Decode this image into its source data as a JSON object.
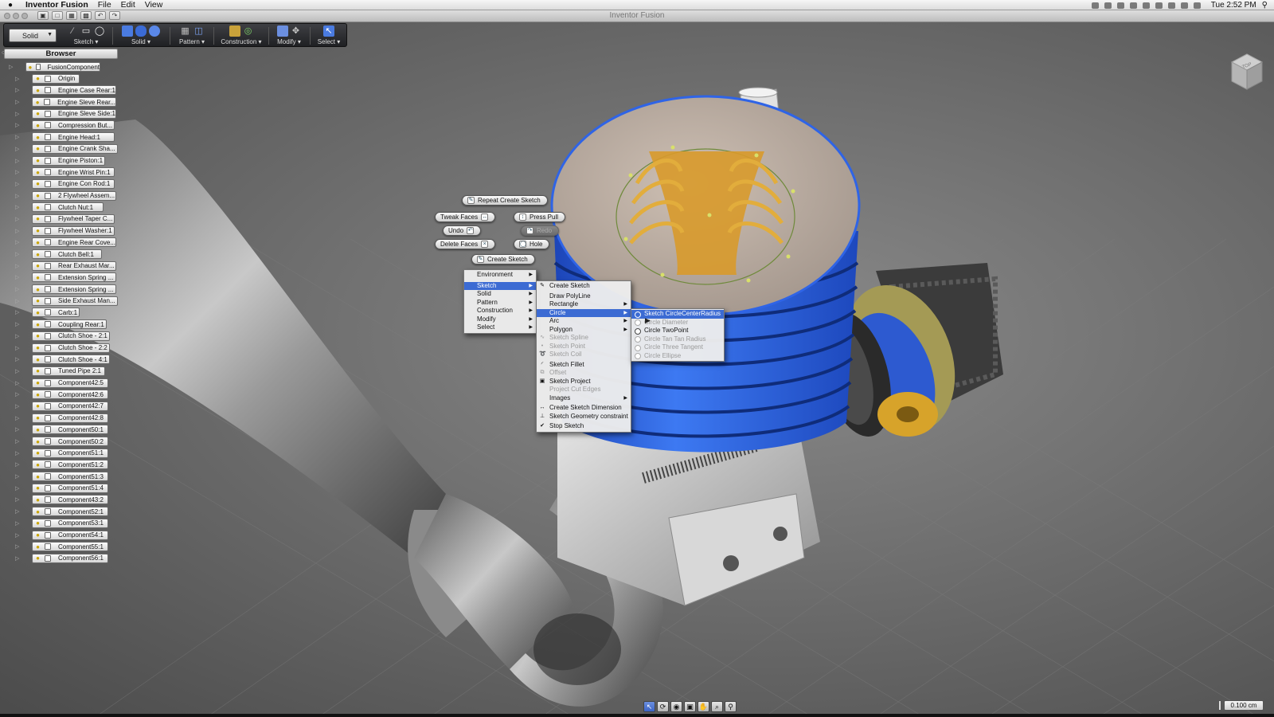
{
  "menubar": {
    "app_name": "Inventor Fusion",
    "menus": [
      "File",
      "Edit",
      "View"
    ],
    "clock": "Tue 2:52 PM"
  },
  "window": {
    "title": "Inventor Fusion"
  },
  "toolbar": {
    "workspace_value": "Solid",
    "groups": [
      {
        "label": "Sketch",
        "icon": "sketch-icon"
      },
      {
        "label": "Solid",
        "icon": "solid-icon"
      },
      {
        "label": "Pattern",
        "icon": "pattern-icon"
      },
      {
        "label": "Construction",
        "icon": "construction-icon"
      },
      {
        "label": "Modify",
        "icon": "modify-icon"
      },
      {
        "label": "Select",
        "icon": "select-arrow-icon"
      }
    ]
  },
  "browser": {
    "title": "Browser",
    "items": [
      {
        "label": "FusionComponent",
        "level": 0
      },
      {
        "label": "Origin",
        "level": 1
      },
      {
        "label": "Engine Case Rear:1",
        "level": 1
      },
      {
        "label": "Engine Sleve Rear...",
        "level": 1
      },
      {
        "label": "Engine Sleve Side:1",
        "level": 1
      },
      {
        "label": "Compression But...",
        "level": 1
      },
      {
        "label": "Engine Head:1",
        "level": 1
      },
      {
        "label": "Engine Crank Sha...",
        "level": 1
      },
      {
        "label": "Engine Piston:1",
        "level": 1
      },
      {
        "label": "Engine Wrist Pin:1",
        "level": 1
      },
      {
        "label": "Engine Con Rod:1",
        "level": 1
      },
      {
        "label": "2 Flywheel Assem...",
        "level": 1
      },
      {
        "label": "Clutch Nut:1",
        "level": 1
      },
      {
        "label": "Flywheel Taper C...",
        "level": 1
      },
      {
        "label": "Flywheel Washer:1",
        "level": 1
      },
      {
        "label": "Engine Rear Cove...",
        "level": 1
      },
      {
        "label": "Clutch Bell:1",
        "level": 1
      },
      {
        "label": "Rear Exhaust Mar...",
        "level": 1
      },
      {
        "label": "Extension Spring ...",
        "level": 1
      },
      {
        "label": "Extension Spring ...",
        "level": 1
      },
      {
        "label": "Side Exhaust Man...",
        "level": 1
      },
      {
        "label": "Carb:1",
        "level": 1
      },
      {
        "label": "Coupling Rear:1",
        "level": 1
      },
      {
        "label": "Clutch Shoe - 2:1",
        "level": 1
      },
      {
        "label": "Clutch Shoe - 2:2",
        "level": 1
      },
      {
        "label": "Clutch Shoe - 4:1",
        "level": 1
      },
      {
        "label": "Tuned Pipe 2:1",
        "level": 1
      },
      {
        "label": "Component42:5",
        "level": 1
      },
      {
        "label": "Component42:6",
        "level": 1
      },
      {
        "label": "Component42:7",
        "level": 1
      },
      {
        "label": "Component42:8",
        "level": 1
      },
      {
        "label": "Component50:1",
        "level": 1
      },
      {
        "label": "Component50:2",
        "level": 1
      },
      {
        "label": "Component51:1",
        "level": 1
      },
      {
        "label": "Component51:2",
        "level": 1
      },
      {
        "label": "Component51:3",
        "level": 1
      },
      {
        "label": "Component51:4",
        "level": 1
      },
      {
        "label": "Component43:2",
        "level": 1
      },
      {
        "label": "Component52:1",
        "level": 1
      },
      {
        "label": "Component53:1",
        "level": 1
      },
      {
        "label": "Component54:1",
        "level": 1
      },
      {
        "label": "Component55:1",
        "level": 1
      },
      {
        "label": "Component56:1",
        "level": 1
      }
    ]
  },
  "marking_menu": {
    "repeat": "Repeat Create Sketch",
    "tweak_faces": "Tweak Faces",
    "press_pull": "Press Pull",
    "undo": "Undo",
    "redo": "Redo",
    "delete_faces": "Delete Faces",
    "hole": "Hole",
    "create_sketch": "Create Sketch"
  },
  "context_menu": {
    "level1": [
      "Environment",
      "Sketch",
      "Solid",
      "Pattern",
      "Construction",
      "Modify",
      "Select"
    ],
    "level2": [
      {
        "label": "Create Sketch",
        "enabled": true,
        "submenu": false,
        "icon": "sketch-icon"
      },
      {
        "label": "Draw PolyLine",
        "enabled": true,
        "submenu": false,
        "icon": ""
      },
      {
        "label": "Rectangle",
        "enabled": true,
        "submenu": true,
        "icon": ""
      },
      {
        "label": "Circle",
        "enabled": true,
        "submenu": true,
        "icon": ""
      },
      {
        "label": "Arc",
        "enabled": true,
        "submenu": true,
        "icon": ""
      },
      {
        "label": "Polygon",
        "enabled": true,
        "submenu": true,
        "icon": ""
      },
      {
        "label": "Sketch Spline",
        "enabled": false,
        "submenu": false,
        "icon": "spline-icon"
      },
      {
        "label": "Sketch Point",
        "enabled": false,
        "submenu": false,
        "icon": "point-icon"
      },
      {
        "label": "Sketch Coil",
        "enabled": false,
        "submenu": false,
        "icon": "coil-icon"
      },
      {
        "label": "Sketch Fillet",
        "enabled": true,
        "submenu": false,
        "icon": "fillet-icon"
      },
      {
        "label": "Offset",
        "enabled": false,
        "submenu": false,
        "icon": "offset-icon"
      },
      {
        "label": "Sketch Project",
        "enabled": true,
        "submenu": false,
        "icon": "project-icon"
      },
      {
        "label": "Project Cut Edges",
        "enabled": false,
        "submenu": false,
        "icon": ""
      },
      {
        "label": "Images",
        "enabled": true,
        "submenu": true,
        "icon": ""
      },
      {
        "label": "Create Sketch Dimension",
        "enabled": true,
        "submenu": false,
        "icon": "dimension-icon"
      },
      {
        "label": "Sketch Geometry constraint",
        "enabled": true,
        "submenu": false,
        "icon": "constraint-icon"
      },
      {
        "label": "Stop Sketch",
        "enabled": true,
        "submenu": false,
        "icon": "stop-icon"
      }
    ],
    "level3": [
      {
        "label": "Sketch CircleCenterRadius",
        "enabled": true
      },
      {
        "label": "Circle Diameter",
        "enabled": false
      },
      {
        "label": "Circle TwoPoint",
        "enabled": true
      },
      {
        "label": "Circle Tan Tan Radius",
        "enabled": false
      },
      {
        "label": "Circle Three Tangent",
        "enabled": false
      },
      {
        "label": "Circle Ellipse",
        "enabled": false
      }
    ]
  },
  "viewcube": {
    "label": "TOP"
  },
  "scale": {
    "value": "0.100 cm"
  },
  "colors": {
    "accent_blue": "#3c6bd3",
    "cylinder_blue": "#2f64e6",
    "sketch_orange": "#d89a2b",
    "background_grey": "#6e6e6e"
  }
}
